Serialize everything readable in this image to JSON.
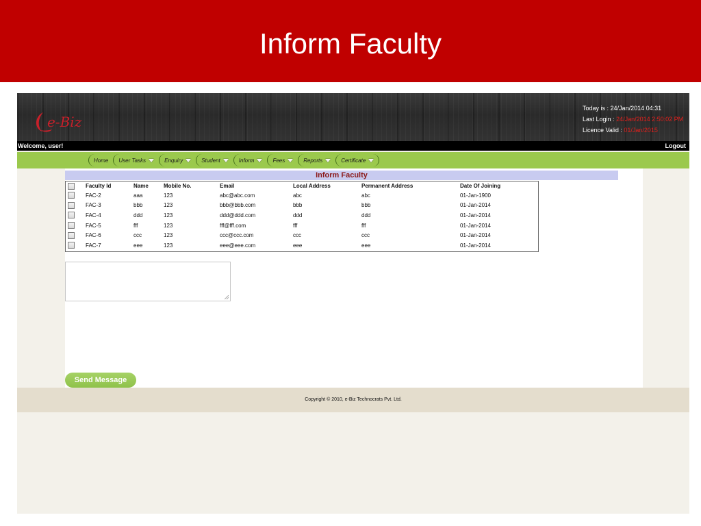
{
  "slide": {
    "title": "Inform Faculty"
  },
  "header": {
    "logo_text": "e-Biz",
    "today_label": "Today is :",
    "today_value": "24/Jan/2014 04:31",
    "last_login_label": "Last Login :",
    "last_login_value": "24/Jan/2014 2:50:02 PM",
    "licence_label": "Licence Valid :",
    "licence_value": "01/Jan/2015"
  },
  "topbar": {
    "welcome": "Welcome,  user!",
    "logout": "Logout"
  },
  "nav": [
    {
      "label": "Home",
      "has_dropdown": false
    },
    {
      "label": "User Tasks",
      "has_dropdown": true
    },
    {
      "label": "Enquiry",
      "has_dropdown": true
    },
    {
      "label": "Student",
      "has_dropdown": true
    },
    {
      "label": "Inform",
      "has_dropdown": true
    },
    {
      "label": "Fees",
      "has_dropdown": true
    },
    {
      "label": "Reports",
      "has_dropdown": true
    },
    {
      "label": "Certificate",
      "has_dropdown": true
    }
  ],
  "page": {
    "heading": "Inform Faculty"
  },
  "table": {
    "columns": [
      "Faculty Id",
      "Name",
      "Mobile No.",
      "Email",
      "Local Address",
      "Permanent Address",
      "Date Of Joining"
    ],
    "rows": [
      [
        "FAC-2",
        "aaa",
        "123",
        "abc@abc.com",
        "abc",
        "abc",
        "01-Jan-1900"
      ],
      [
        "FAC-3",
        "bbb",
        "123",
        "bbb@bbb.com",
        "bbb",
        "bbb",
        "01-Jan-2014"
      ],
      [
        "FAC-4",
        "ddd",
        "123",
        "ddd@ddd.com",
        "ddd",
        "ddd",
        "01-Jan-2014"
      ],
      [
        "FAC-5",
        "fff",
        "123",
        "fff@fff.com",
        "fff",
        "fff",
        "01-Jan-2014"
      ],
      [
        "FAC-6",
        "ccc",
        "123",
        "ccc@ccc.com",
        "ccc",
        "ccc",
        "01-Jan-2014"
      ],
      [
        "FAC-7",
        "eee",
        "123",
        "eee@eee.com",
        "eee",
        "eee",
        "01-Jan-2014"
      ]
    ]
  },
  "message": {
    "value": "",
    "send_label": "Send Message"
  },
  "footer": {
    "copyright": "Copyright © 2010, e-Biz Technocrats Pvt. Ltd."
  },
  "colors": {
    "banner": "#c00000",
    "nav_green": "#9bc94d",
    "heading_bg": "#c8cbf0",
    "heading_text": "#8b1a1a",
    "accent_red": "#e2201c"
  }
}
